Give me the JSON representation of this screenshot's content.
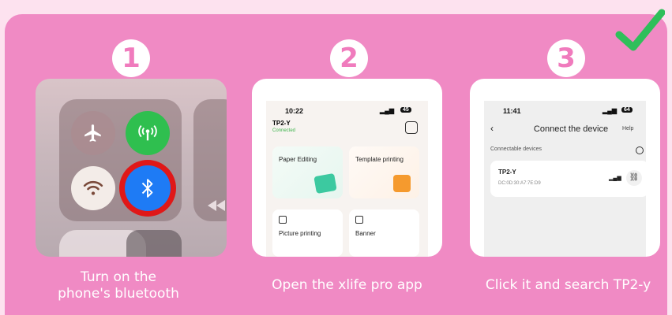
{
  "steps": [
    {
      "number": "1",
      "caption_line1": "Turn on the",
      "caption_line2": "phone's bluetooth"
    },
    {
      "number": "2",
      "caption": "Open the xlife pro app"
    },
    {
      "number": "3",
      "caption": "Click it and search TP2-y"
    }
  ],
  "phone2": {
    "time": "10:22",
    "battery": "45",
    "device_name": "TP2-Y",
    "status": "Connected",
    "cards": [
      "Paper Editing",
      "Template printing",
      "Picture printing",
      "Banner"
    ]
  },
  "phone3": {
    "time": "11:41",
    "battery": "64",
    "title": "Connect the device",
    "help": "Help",
    "section_label": "Connectable devices",
    "device_name": "TP2-Y",
    "device_mac": "DC:0D:30:A7:7E:D9"
  },
  "colors": {
    "panel": "#f08ac4",
    "background": "#fde2ef",
    "check": "#2fbf5a",
    "bluetooth": "#1e7bf5",
    "highlight_ring": "#e01818",
    "cellular": "#2fbf4f"
  },
  "icons": [
    "check-icon",
    "airplane-icon",
    "cellular-icon",
    "wifi-icon",
    "bluetooth-icon",
    "rewind-icon",
    "back-icon",
    "refresh-icon",
    "signal-icon",
    "link-icon"
  ]
}
